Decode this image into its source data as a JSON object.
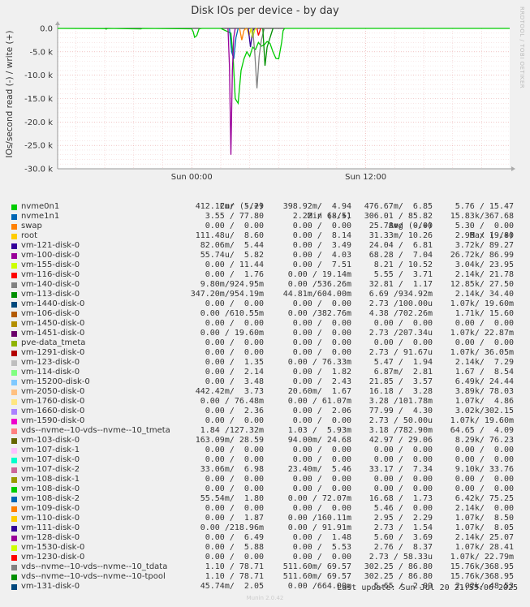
{
  "chart_data": {
    "type": "line",
    "title": "Disk IOs per device - by day",
    "ylabel": "IOs/second read (-) / write (+)",
    "ylim": [
      -30000,
      0
    ],
    "yticks": [
      {
        "v": 0,
        "label": "0.0"
      },
      {
        "v": -5000,
        "label": "-5.0 k"
      },
      {
        "v": -10000,
        "label": "-10.0 k"
      },
      {
        "v": -15000,
        "label": "-15.0 k"
      },
      {
        "v": -20000,
        "label": "-20.0 k"
      },
      {
        "v": -25000,
        "label": "-25.0 k"
      },
      {
        "v": -30000,
        "label": "-30.0 k"
      }
    ],
    "xlim_hours": [
      -9.25,
      21.93
    ],
    "xticks": [
      {
        "h": 0,
        "label": "Sun 00:00"
      },
      {
        "h": 12,
        "label": "Sun 12:00"
      }
    ],
    "grid": true,
    "series_values_note": "",
    "traces": [
      {
        "color": "#00cc00",
        "points": [
          [
            -9.25,
            0
          ],
          [
            -6.0,
            -40
          ],
          [
            -5.9,
            -150
          ],
          [
            -5.8,
            0
          ],
          [
            -3.5,
            -100
          ],
          [
            -3.4,
            0
          ],
          [
            0.0,
            -80
          ],
          [
            0.1,
            -700
          ],
          [
            0.2,
            -1900
          ],
          [
            0.35,
            -1500
          ],
          [
            0.5,
            -100
          ],
          [
            0.7,
            0
          ],
          [
            2.0,
            0
          ],
          [
            2.7,
            -1000
          ],
          [
            2.85,
            -6000
          ],
          [
            3.0,
            -15000
          ],
          [
            3.2,
            -16000
          ],
          [
            3.4,
            -9000
          ],
          [
            3.6,
            -6500
          ],
          [
            3.8,
            -5000
          ],
          [
            4.0,
            -6000
          ],
          [
            4.2,
            -4000
          ],
          [
            4.4,
            -4500
          ],
          [
            4.6,
            -3000
          ],
          [
            4.8,
            -3800
          ],
          [
            5.0,
            -3500
          ],
          [
            5.2,
            -2800
          ],
          [
            5.4,
            -3200
          ],
          [
            5.6,
            -5000
          ],
          [
            5.8,
            -6400
          ],
          [
            6.0,
            -6500
          ],
          [
            6.2,
            -3000
          ],
          [
            6.3,
            -500
          ],
          [
            6.4,
            0
          ],
          [
            21.93,
            0
          ]
        ]
      },
      {
        "color": "#0066b3",
        "points": [
          [
            2.6,
            0
          ],
          [
            2.75,
            -5000
          ],
          [
            2.9,
            -6500
          ],
          [
            3.05,
            -2000
          ],
          [
            3.2,
            0
          ]
        ]
      },
      {
        "color": "#ff8000",
        "points": [
          [
            3.3,
            0
          ],
          [
            3.45,
            -2500
          ],
          [
            3.6,
            -400
          ],
          [
            3.75,
            0
          ]
        ]
      },
      {
        "color": "#ffcc00",
        "points": [
          [
            3.8,
            0
          ],
          [
            3.95,
            -1500
          ],
          [
            4.1,
            0
          ]
        ]
      },
      {
        "color": "#330099",
        "points": [
          [
            3.9,
            0
          ],
          [
            4.05,
            -4000
          ],
          [
            4.2,
            -500
          ],
          [
            4.35,
            0
          ]
        ]
      },
      {
        "color": "#990099",
        "points": [
          [
            2.5,
            0
          ],
          [
            2.6,
            -8000
          ],
          [
            2.7,
            -27000
          ],
          [
            2.8,
            -9000
          ],
          [
            2.9,
            -2000
          ],
          [
            3.0,
            0
          ]
        ]
      },
      {
        "color": "#ccff00",
        "points": [
          [
            4.1,
            0
          ],
          [
            4.2,
            -2000
          ],
          [
            4.35,
            -200
          ],
          [
            4.5,
            0
          ]
        ]
      },
      {
        "color": "#ff0000",
        "points": [
          [
            4.5,
            0
          ],
          [
            4.6,
            -1500
          ],
          [
            4.75,
            0
          ]
        ]
      },
      {
        "color": "#808080",
        "points": [
          [
            4.2,
            0
          ],
          [
            4.35,
            -5500
          ],
          [
            4.5,
            -12800
          ],
          [
            4.65,
            -6000
          ],
          [
            4.8,
            -2500
          ],
          [
            5.0,
            0
          ]
        ]
      },
      {
        "color": "#008f00",
        "points": [
          [
            4.9,
            0
          ],
          [
            5.05,
            -8000
          ],
          [
            5.2,
            -4000
          ],
          [
            5.4,
            -2000
          ],
          [
            5.6,
            0
          ]
        ]
      }
    ]
  },
  "legend": {
    "headers": [
      "Cur (-/+)",
      "Min (-/+)",
      "Avg (-/+)",
      "Max (-/+)"
    ],
    "rows": [
      {
        "name": "nvme0n1",
        "color": "#00cc00",
        "cur": "412.12m/  5.29",
        "min": "398.92m/  4.94",
        "avg": "476.67m/  6.85",
        "max": "5.76 / 15.47"
      },
      {
        "name": "nvme1n1",
        "color": "#0066b3",
        "cur": "3.55 / 77.80",
        "min": "2.22 / 68.51",
        "avg": "306.01 / 85.82",
        "max": "15.83k/367.68"
      },
      {
        "name": "swap",
        "color": "#ff8000",
        "cur": "0.00 /  0.00",
        "min": "0.00 /  0.00",
        "avg": "25.78m/  0.00",
        "max": "5.30 /  0.00"
      },
      {
        "name": "root",
        "color": "#ffcc00",
        "cur": "111.48u/  8.60",
        "min": "0.00 /  8.14",
        "avg": "31.33m/ 10.26",
        "max": "2.98 / 19.80"
      },
      {
        "name": "vm-121-disk-0",
        "color": "#330099",
        "cur": "82.06m/  5.44",
        "min": "0.00 /  3.49",
        "avg": "24.04 /  6.81",
        "max": "3.72k/ 89.27"
      },
      {
        "name": "vm-100-disk-0",
        "color": "#990099",
        "cur": "55.74u/  5.82",
        "min": "0.00 /  4.03",
        "avg": "68.28 /  7.04",
        "max": "26.72k/ 86.99"
      },
      {
        "name": "vm-155-disk-0",
        "color": "#ccff00",
        "cur": "0.00 / 11.44",
        "min": "0.00 /  7.51",
        "avg": "8.21 / 10.52",
        "max": "3.04k/ 23.95"
      },
      {
        "name": "vm-116-disk-0",
        "color": "#ff0000",
        "cur": "0.00 /  1.76",
        "min": "0.00 / 19.14m",
        "avg": "5.55 /  3.71",
        "max": "2.14k/ 21.78"
      },
      {
        "name": "vm-140-disk-0",
        "color": "#808080",
        "cur": "9.80m/924.95m",
        "min": "0.00 /536.26m",
        "avg": "32.81 /  1.17",
        "max": "12.85k/ 27.50"
      },
      {
        "name": "vm-113-disk-0",
        "color": "#008f00",
        "cur": "347.20m/954.19m",
        "min": "44.81m/604.00m",
        "avg": "6.69 /934.92m",
        "max": "2.14k/ 34.40"
      },
      {
        "name": "vm-1440-disk-0",
        "color": "#00487d",
        "cur": "0.00 /  0.00",
        "min": "0.00 /  0.00",
        "avg": "2.73 /100.00u",
        "max": "1.07k/ 19.60m"
      },
      {
        "name": "vm-106-disk-0",
        "color": "#b35a00",
        "cur": "0.00 /610.55m",
        "min": "0.00 /382.76m",
        "avg": "4.38 /702.26m",
        "max": "1.71k/ 15.60"
      },
      {
        "name": "vm-1450-disk-0",
        "color": "#b38f00",
        "cur": "0.00 /  0.00",
        "min": "0.00 /  0.00",
        "avg": "0.00 /  0.00",
        "max": "0.00 /  0.00"
      },
      {
        "name": "vm-1451-disk-0",
        "color": "#6b006b",
        "cur": "0.00 / 19.60m",
        "min": "0.00 /  0.00",
        "avg": "2.73 /207.34u",
        "max": "1.07k/ 22.87m"
      },
      {
        "name": "pve-data_tmeta",
        "color": "#8fb300",
        "cur": "0.00 /  0.00",
        "min": "0.00 /  0.00",
        "avg": "0.00 /  0.00",
        "max": "0.00 /  0.00"
      },
      {
        "name": "vm-1291-disk-0",
        "color": "#b30000",
        "cur": "0.00 /  0.00",
        "min": "0.00 /  0.00",
        "avg": "2.73 / 91.67u",
        "max": "1.07k/ 36.05m"
      },
      {
        "name": "vm-123-disk-0",
        "color": "#bebebe",
        "cur": "0.00 /  1.35",
        "min": "0.00 / 76.33m",
        "avg": "5.47 /  1.94",
        "max": "2.14k/  7.29"
      },
      {
        "name": "vm-114-disk-0",
        "color": "#80ff80",
        "cur": "0.00 /  2.14",
        "min": "0.00 /  1.82",
        "avg": "6.87m/  2.81",
        "max": "1.67 /  8.54"
      },
      {
        "name": "vm-15200-disk-0",
        "color": "#80c9ff",
        "cur": "0.00 /  3.48",
        "min": "0.00 /  2.43",
        "avg": "21.85 /  3.57",
        "max": "6.49k/ 24.44"
      },
      {
        "name": "vm-2050-disk-0",
        "color": "#ffc080",
        "cur": "442.42m/  3.73",
        "min": "20.60m/  1.67",
        "avg": "16.18 /  3.28",
        "max": "3.89k/ 78.03"
      },
      {
        "name": "vm-1760-disk-0",
        "color": "#ffe680",
        "cur": "0.00 / 76.48m",
        "min": "0.00 / 61.07m",
        "avg": "3.28 /101.78m",
        "max": "1.07k/  4.86"
      },
      {
        "name": "vm-1660-disk-0",
        "color": "#aa80ff",
        "cur": "0.00 /  2.36",
        "min": "0.00 /  2.06",
        "avg": "77.99 /  4.30",
        "max": "3.02k/302.15"
      },
      {
        "name": "vm-1590-disk-0",
        "color": "#ee00cc",
        "cur": "0.00 /  0.00",
        "min": "0.00 /  0.00",
        "avg": "2.73 / 50.00u",
        "max": "1.07k/ 19.60m"
      },
      {
        "name": "vds--nvme--10-vds--nvme--10_tmeta",
        "color": "#ff8080",
        "cur": "1.84 /127.32m",
        "min": "1.03 /  5.93m",
        "avg": "3.18 /782.90m",
        "max": "64.65 /  4.09"
      },
      {
        "name": "vm-103-disk-0",
        "color": "#666600",
        "cur": "163.09m/ 28.59",
        "min": "94.00m/ 24.68",
        "avg": "42.97 / 29.06",
        "max": "8.29k/ 76.23"
      },
      {
        "name": "vm-107-disk-1",
        "color": "#ffbfff",
        "cur": "0.00 /  0.00",
        "min": "0.00 /  0.00",
        "avg": "0.00 /  0.00",
        "max": "0.00 /  0.00"
      },
      {
        "name": "vm-107-disk-0",
        "color": "#00ffcc",
        "cur": "0.00 /  0.00",
        "min": "0.00 /  0.00",
        "avg": "0.00 /  0.00",
        "max": "0.00 /  0.00"
      },
      {
        "name": "vm-107-disk-2",
        "color": "#cc6699",
        "cur": "33.06m/  6.98",
        "min": "23.40m/  5.46",
        "avg": "33.17 /  7.34",
        "max": "9.10k/ 33.76"
      },
      {
        "name": "vm-108-disk-1",
        "color": "#999900",
        "cur": "0.00 /  0.00",
        "min": "0.00 /  0.00",
        "avg": "0.00 /  0.00",
        "max": "0.00 /  0.00"
      },
      {
        "name": "vm-108-disk-0",
        "color": "#00cc00",
        "cur": "0.00 /  0.00",
        "min": "0.00 /  0.00",
        "avg": "0.00 /  0.00",
        "max": "0.00 /  0.00"
      },
      {
        "name": "vm-108-disk-2",
        "color": "#0066b3",
        "cur": "55.54m/  1.80",
        "min": "0.00 / 72.07m",
        "avg": "16.68 /  1.73",
        "max": "6.42k/ 75.25"
      },
      {
        "name": "vm-109-disk-0",
        "color": "#ff8000",
        "cur": "0.00 /  0.00",
        "min": "0.00 /  0.00",
        "avg": "5.46 /  0.00",
        "max": "2.14k/  0.00"
      },
      {
        "name": "vm-110-disk-0",
        "color": "#ffcc00",
        "cur": "0.00 /  1.87",
        "min": "0.00 /160.11m",
        "avg": "2.95 /  2.29",
        "max": "1.07k/  8.50"
      },
      {
        "name": "vm-111-disk-0",
        "color": "#330099",
        "cur": "0.00 /218.96m",
        "min": "0.00 / 91.91m",
        "avg": "2.73 /  1.54",
        "max": "1.07k/  8.05"
      },
      {
        "name": "vm-128-disk-0",
        "color": "#990099",
        "cur": "0.00 /  6.49",
        "min": "0.00 /  1.48",
        "avg": "5.60 /  3.69",
        "max": "2.14k/ 25.07"
      },
      {
        "name": "vm-1530-disk-0",
        "color": "#ccff00",
        "cur": "0.00 /  5.88",
        "min": "0.00 /  5.53",
        "avg": "2.76 /  8.37",
        "max": "1.07k/ 28.41"
      },
      {
        "name": "vm-1230-disk-0",
        "color": "#ff0000",
        "cur": "0.00 /  0.00",
        "min": "0.00 /  0.00",
        "avg": "2.73 / 58.33u",
        "max": "1.07k/ 22.79m"
      },
      {
        "name": "vds--nvme--10-vds--nvme--10_tdata",
        "color": "#808080",
        "cur": "1.10 / 78.71",
        "min": "511.60m/ 69.57",
        "avg": "302.25 / 86.80",
        "max": "15.76k/368.95"
      },
      {
        "name": "vds--nvme--10-vds--nvme--10-tpool",
        "color": "#008f00",
        "cur": "1.10 / 78.71",
        "min": "511.60m/ 69.57",
        "avg": "302.25 / 86.80",
        "max": "15.76k/368.95"
      },
      {
        "name": "vm-131-disk-0",
        "color": "#00487d",
        "cur": "45.74m/  2.05",
        "min": "0.00 /664.00m",
        "avg": "5.65 /  2.09",
        "max": "2.02k/ 48.53"
      }
    ]
  },
  "last_update": "Last update: Sun Jul 20 21:55:06 2025",
  "watermark": "RRDTOOL / TOBI OETIKER",
  "footer": "Munin 2.0.42"
}
